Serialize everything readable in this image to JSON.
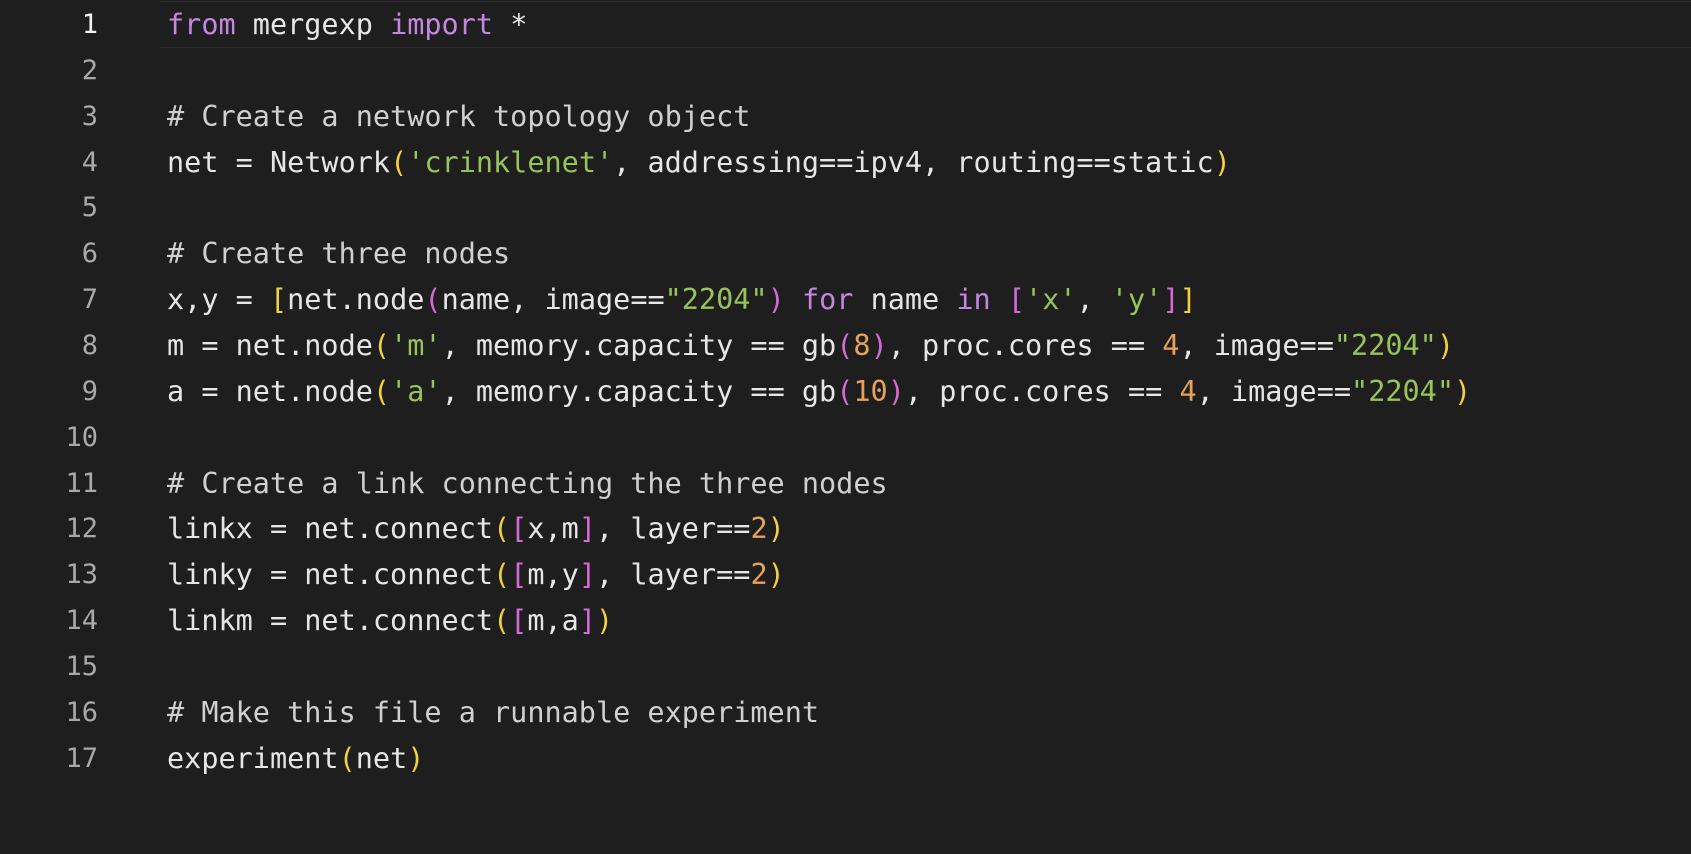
{
  "editor": {
    "current_line": 1,
    "lines": [
      {
        "num": "1",
        "tokens": [
          {
            "t": "from",
            "c": "keyword"
          },
          {
            "t": " mergexp ",
            "c": "plain"
          },
          {
            "t": "import",
            "c": "keyword"
          },
          {
            "t": " *",
            "c": "plain"
          }
        ]
      },
      {
        "num": "2",
        "tokens": []
      },
      {
        "num": "3",
        "tokens": [
          {
            "t": "# Create a network topology object",
            "c": "comment"
          }
        ]
      },
      {
        "num": "4",
        "tokens": [
          {
            "t": "net = Network",
            "c": "plain"
          },
          {
            "t": "(",
            "c": "bracket-1"
          },
          {
            "t": "'crinklenet'",
            "c": "string"
          },
          {
            "t": ", addressing==ipv4, routing==static",
            "c": "plain"
          },
          {
            "t": ")",
            "c": "bracket-1"
          }
        ]
      },
      {
        "num": "5",
        "tokens": []
      },
      {
        "num": "6",
        "tokens": [
          {
            "t": "# Create three nodes",
            "c": "comment"
          }
        ]
      },
      {
        "num": "7",
        "tokens": [
          {
            "t": "x,y = ",
            "c": "plain"
          },
          {
            "t": "[",
            "c": "bracket-1"
          },
          {
            "t": "net.node",
            "c": "plain"
          },
          {
            "t": "(",
            "c": "bracket-2"
          },
          {
            "t": "name, image==",
            "c": "plain"
          },
          {
            "t": "\"2204\"",
            "c": "string"
          },
          {
            "t": ")",
            "c": "bracket-2"
          },
          {
            "t": " ",
            "c": "plain"
          },
          {
            "t": "for",
            "c": "keyword"
          },
          {
            "t": " name ",
            "c": "plain"
          },
          {
            "t": "in",
            "c": "keyword"
          },
          {
            "t": " ",
            "c": "plain"
          },
          {
            "t": "[",
            "c": "bracket-2"
          },
          {
            "t": "'x'",
            "c": "string"
          },
          {
            "t": ", ",
            "c": "plain"
          },
          {
            "t": "'y'",
            "c": "string"
          },
          {
            "t": "]",
            "c": "bracket-2"
          },
          {
            "t": "]",
            "c": "bracket-1"
          }
        ]
      },
      {
        "num": "8",
        "tokens": [
          {
            "t": "m = net.node",
            "c": "plain"
          },
          {
            "t": "(",
            "c": "bracket-1"
          },
          {
            "t": "'m'",
            "c": "string"
          },
          {
            "t": ", memory.capacity == gb",
            "c": "plain"
          },
          {
            "t": "(",
            "c": "bracket-2"
          },
          {
            "t": "8",
            "c": "number"
          },
          {
            "t": ")",
            "c": "bracket-2"
          },
          {
            "t": ", proc.cores == ",
            "c": "plain"
          },
          {
            "t": "4",
            "c": "number"
          },
          {
            "t": ", image==",
            "c": "plain"
          },
          {
            "t": "\"2204\"",
            "c": "string"
          },
          {
            "t": ")",
            "c": "bracket-1"
          }
        ]
      },
      {
        "num": "9",
        "tokens": [
          {
            "t": "a = net.node",
            "c": "plain"
          },
          {
            "t": "(",
            "c": "bracket-1"
          },
          {
            "t": "'a'",
            "c": "string"
          },
          {
            "t": ", memory.capacity == gb",
            "c": "plain"
          },
          {
            "t": "(",
            "c": "bracket-2"
          },
          {
            "t": "10",
            "c": "number"
          },
          {
            "t": ")",
            "c": "bracket-2"
          },
          {
            "t": ", proc.cores == ",
            "c": "plain"
          },
          {
            "t": "4",
            "c": "number"
          },
          {
            "t": ", image==",
            "c": "plain"
          },
          {
            "t": "\"2204\"",
            "c": "string"
          },
          {
            "t": ")",
            "c": "bracket-1"
          }
        ]
      },
      {
        "num": "10",
        "tokens": []
      },
      {
        "num": "11",
        "tokens": [
          {
            "t": "# Create a link connecting the three nodes",
            "c": "comment"
          }
        ]
      },
      {
        "num": "12",
        "tokens": [
          {
            "t": "linkx = net.connect",
            "c": "plain"
          },
          {
            "t": "(",
            "c": "bracket-1"
          },
          {
            "t": "[",
            "c": "bracket-2"
          },
          {
            "t": "x,m",
            "c": "plain"
          },
          {
            "t": "]",
            "c": "bracket-2"
          },
          {
            "t": ", layer==",
            "c": "plain"
          },
          {
            "t": "2",
            "c": "number"
          },
          {
            "t": ")",
            "c": "bracket-1"
          }
        ]
      },
      {
        "num": "13",
        "tokens": [
          {
            "t": "linky = net.connect",
            "c": "plain"
          },
          {
            "t": "(",
            "c": "bracket-1"
          },
          {
            "t": "[",
            "c": "bracket-2"
          },
          {
            "t": "m,y",
            "c": "plain"
          },
          {
            "t": "]",
            "c": "bracket-2"
          },
          {
            "t": ", layer==",
            "c": "plain"
          },
          {
            "t": "2",
            "c": "number"
          },
          {
            "t": ")",
            "c": "bracket-1"
          }
        ]
      },
      {
        "num": "14",
        "tokens": [
          {
            "t": "linkm = net.connect",
            "c": "plain"
          },
          {
            "t": "(",
            "c": "bracket-1"
          },
          {
            "t": "[",
            "c": "bracket-2"
          },
          {
            "t": "m,a",
            "c": "plain"
          },
          {
            "t": "]",
            "c": "bracket-2"
          },
          {
            "t": ")",
            "c": "bracket-1"
          }
        ]
      },
      {
        "num": "15",
        "tokens": []
      },
      {
        "num": "16",
        "tokens": [
          {
            "t": "# Make this file a runnable experiment",
            "c": "comment"
          }
        ]
      },
      {
        "num": "17",
        "tokens": [
          {
            "t": "experiment",
            "c": "plain"
          },
          {
            "t": "(",
            "c": "bracket-1"
          },
          {
            "t": "net",
            "c": "plain"
          },
          {
            "t": ")",
            "c": "bracket-1"
          }
        ]
      }
    ]
  },
  "colors": {
    "background": "#1e1e1e",
    "plain": "#e6e6e6",
    "keyword": "#c586e0",
    "comment": "#d0d0d0",
    "string": "#98c35a",
    "number": "#e8a15c",
    "bracket_level_1": "#f3d03e",
    "bracket_level_2": "#d46ad6",
    "line_number": "#a9a9a9",
    "line_number_active": "#f0f0f0"
  }
}
